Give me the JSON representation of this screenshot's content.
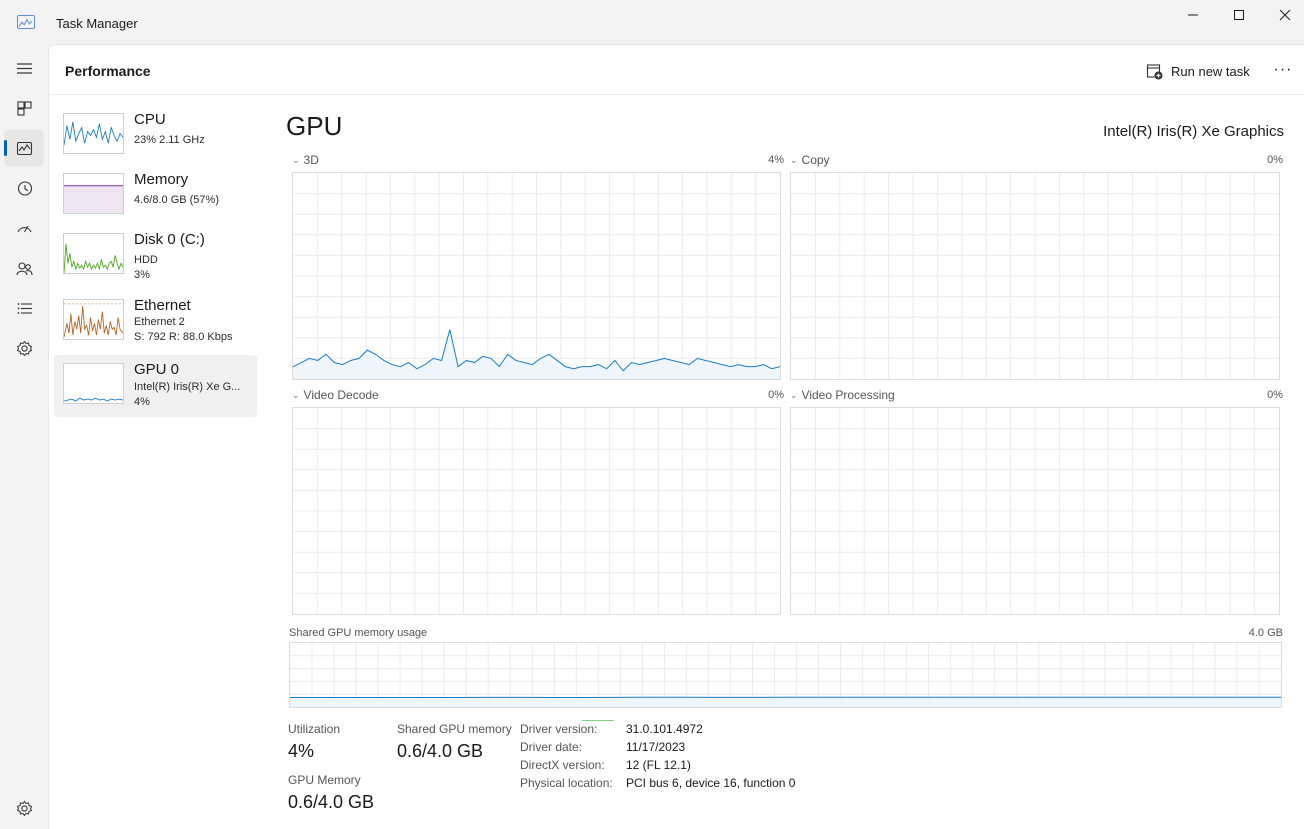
{
  "window": {
    "title": "Task Manager"
  },
  "header": {
    "title": "Performance",
    "run_task_label": "Run new task",
    "more_label": "···"
  },
  "devices": [
    {
      "name": "CPU",
      "line1": "23%  2.11 GHz",
      "line2": "",
      "line3": "",
      "color": "#1a7bc4"
    },
    {
      "name": "Memory",
      "line1": "4.6/8.0 GB (57%)",
      "line2": "",
      "line3": "",
      "color": "#8b2e9e"
    },
    {
      "name": "Disk 0 (C:)",
      "line1": "HDD",
      "line2": "3%",
      "line3": "",
      "color": "#4aa81c"
    },
    {
      "name": "Ethernet",
      "line1": "Ethernet 2",
      "line2": "S: 792  R: 88.0 Kbps",
      "line3": "",
      "color": "#b5651d"
    },
    {
      "name": "GPU 0",
      "line1": "Intel(R) Iris(R) Xe G...",
      "line2": "4%",
      "line3": "",
      "color": "#1a7bc4"
    }
  ],
  "gpu": {
    "title": "GPU",
    "model": "Intel(R) Iris(R) Xe Graphics",
    "engines": [
      {
        "name": "3D",
        "pct": "4%"
      },
      {
        "name": "Copy",
        "pct": "0%"
      },
      {
        "name": "Video Decode",
        "pct": "0%"
      },
      {
        "name": "Video Processing",
        "pct": "0%"
      }
    ],
    "shared_label": "Shared GPU memory usage",
    "shared_max": "4.0 GB",
    "line_color": "#1a7bc4"
  },
  "stats": {
    "utilization_label": "Utilization",
    "utilization_value": "4%",
    "shared_mem_label": "Shared GPU memory",
    "shared_mem_value": "0.6/4.0 GB",
    "gpu_mem_label": "GPU Memory",
    "gpu_mem_value": "0.6/4.0 GB"
  },
  "details": [
    {
      "key": "Driver version:",
      "value": "31.0.101.4972"
    },
    {
      "key": "Driver date:",
      "value": "11/17/2023"
    },
    {
      "key": "DirectX version:",
      "value": "12 (FL 12.1)"
    },
    {
      "key": "Physical location:",
      "value": "PCI bus 6, device 16, function 0"
    }
  ],
  "series": {
    "d3_utilization_pct": [
      6,
      8,
      10,
      9,
      12,
      8,
      7,
      9,
      10,
      14,
      12,
      9,
      7,
      6,
      8,
      5,
      7,
      10,
      9,
      24,
      6,
      9,
      8,
      11,
      10,
      6,
      12,
      9,
      8,
      7,
      10,
      12,
      9,
      6,
      5,
      6,
      6,
      7,
      5,
      9,
      4,
      8,
      7,
      8,
      9,
      10,
      9,
      8,
      7,
      10,
      9,
      8,
      7,
      6,
      7,
      6,
      6,
      7,
      5,
      6
    ],
    "shared_usage_pct": [
      14.8,
      14.8,
      14.9,
      14.9,
      14.8,
      14.8,
      15.0,
      15.0,
      14.9,
      14.9,
      15.1,
      15.2,
      15.2,
      15.1,
      15.0,
      15.2,
      15.3,
      15.2,
      15.3,
      15.2,
      15.2,
      15.3,
      15.3,
      15.3,
      15.2,
      15.2,
      15.3,
      15.2,
      15.2,
      15.2,
      15.2
    ]
  }
}
